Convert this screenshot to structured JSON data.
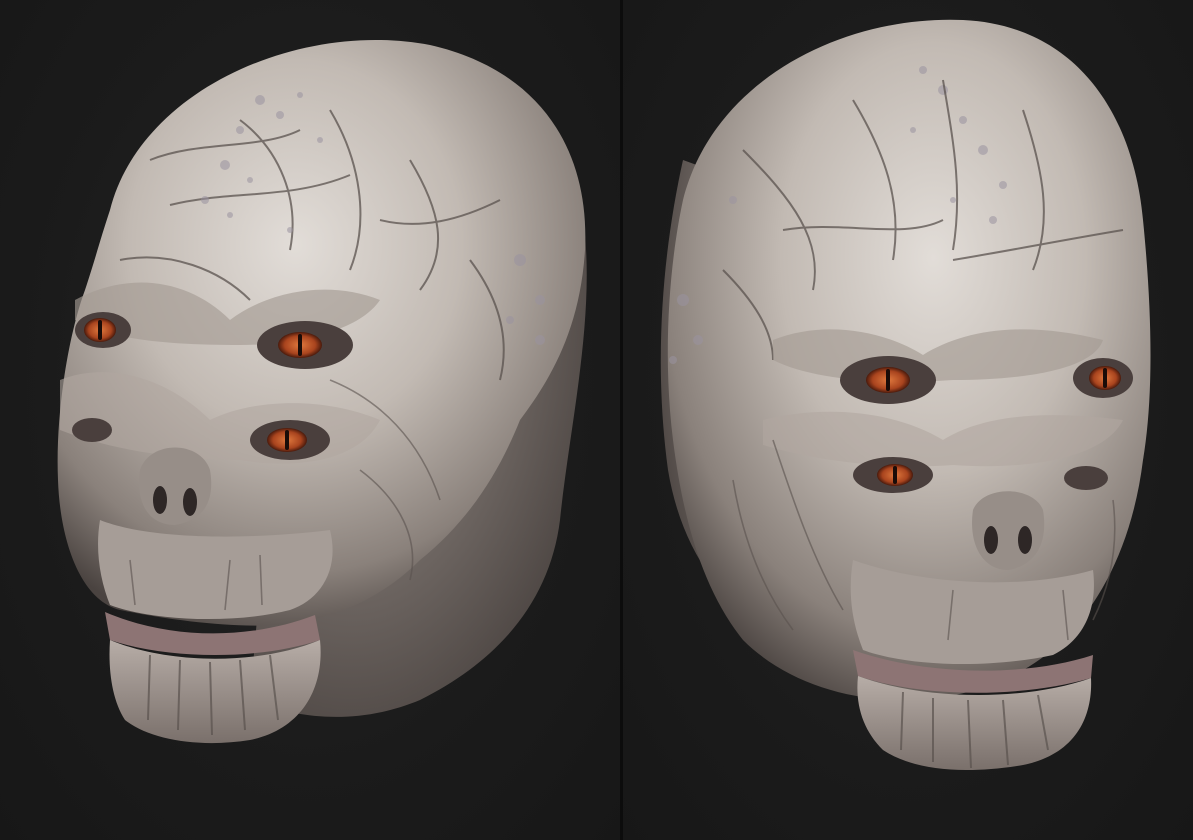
{
  "image": {
    "subject": "",
    "views": [
      {
        "name": "three-quarter-left-view"
      },
      {
        "name": "three-quarter-right-view"
      }
    ]
  },
  "colors": {
    "background": "#1b1b1b",
    "divider": "#0c0c0c",
    "skin_light": "#d8d2cc",
    "skin_mid": "#b3aaa3",
    "skin_shadow": "#6e6561",
    "skin_deep": "#3e3836",
    "lip": "#8d7474",
    "eye_iris": "#c0582a",
    "eye_pupil": "#1a0c08",
    "spots": "#9a93a0"
  }
}
